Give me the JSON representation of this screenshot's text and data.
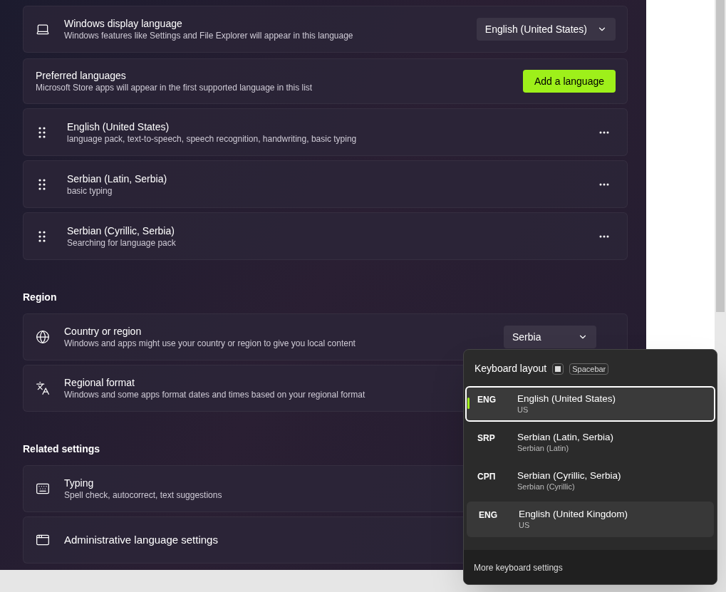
{
  "display_language": {
    "title": "Windows display language",
    "description": "Windows features like Settings and File Explorer will appear in this language",
    "value": "English (United States)"
  },
  "preferred": {
    "title": "Preferred languages",
    "description": "Microsoft Store apps will appear in the first supported language in this list",
    "button": "Add a language"
  },
  "languages": [
    {
      "name": "English (United States)",
      "features": "language pack, text-to-speech, speech recognition, handwriting, basic typing"
    },
    {
      "name": "Serbian (Latin, Serbia)",
      "features": "basic typing"
    },
    {
      "name": "Serbian (Cyrillic, Serbia)",
      "features": "Searching for language pack"
    }
  ],
  "region": {
    "heading": "Region",
    "items": [
      {
        "kind": "globe",
        "title": "Country or region",
        "description": "Windows and apps might use your country or region to give you local content",
        "value": "Serbia"
      },
      {
        "kind": "format",
        "title": "Regional format",
        "description": "Windows and some apps format dates and times based on your regional format"
      }
    ]
  },
  "related": {
    "heading": "Related settings",
    "items": [
      {
        "kind": "keyboard",
        "title": "Typing",
        "description": "Spell check, autocorrect, text suggestions"
      },
      {
        "kind": "admin",
        "title": "Administrative language settings"
      }
    ]
  },
  "flyout": {
    "title": "Keyboard layout",
    "shortcut": "Spacebar",
    "layouts": [
      {
        "code": "ENG",
        "name": "English (United States)",
        "layout": "US",
        "selected": true,
        "hovered": false
      },
      {
        "code": "SRP",
        "name": "Serbian (Latin, Serbia)",
        "layout": "Serbian (Latin)",
        "selected": false,
        "hovered": false
      },
      {
        "code": "СРП",
        "name": "Serbian (Cyrillic, Serbia)",
        "layout": "Serbian (Cyrillic)",
        "selected": false,
        "hovered": false
      },
      {
        "code": "ENG",
        "name": "English (United Kingdom)",
        "layout": "US",
        "selected": false,
        "hovered": true
      }
    ],
    "footer": "More keyboard settings"
  }
}
